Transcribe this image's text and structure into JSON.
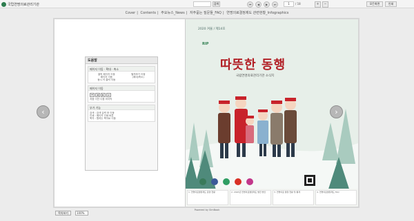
{
  "header": {
    "brand_text": "국립연명의료관리기관",
    "search_placeholder": "",
    "search_button": "검색",
    "nav": {
      "first": "⏮",
      "prev": "◀",
      "next": "▶",
      "last": "⏭"
    },
    "page_input_value": "1",
    "page_total": "/ 18",
    "buttons": {
      "fit": "모든화면",
      "print": "인쇄"
    }
  },
  "menu": {
    "items": [
      "Cover",
      "Contents",
      "주요뉴스_News",
      "자주묻는 질문들_FAQ",
      "연명의료결정제도 관련현황_Infographics"
    ],
    "separator": "|"
  },
  "help": {
    "title": "도움말",
    "sections": [
      {
        "heading": "페이지 이동 · 확대 · 축소",
        "left": "클릭 페이지 이동\n페이지 이동\n동시 키 클릭 이동",
        "right": "펼쳐보기 이동\n(확대/축소)"
      },
      {
        "heading": "페이지 이동",
        "icons": [
          "⏮",
          "◀",
          "▶",
          "⏭"
        ],
        "labels": "처음  이전  다음  마지막"
      },
      {
        "heading": "부가 기능",
        "text": "검색 : 검색 입력 후 이동\n인쇄 : 페이지 인쇄 버튼\n목차 : 원하는 목차로 이동"
      }
    ]
  },
  "cover": {
    "issue": "2020 겨울 / 제14호",
    "logo": "RIP",
    "title": "따뜻한 동행",
    "subtitle": "국립연명의료관리기관 소식지",
    "strip": [
      "1. 연명의료결정제도 운영 현황",
      "2. 2020년 연명의료결정제도 발전 방안",
      "3. 연명의료 결정 현황 및 통계",
      "4. 연명의료결정제도 FAQ"
    ]
  },
  "footer": {
    "button": "목차보기",
    "zoom_value": "100%",
    "powered": "Powered by SimBook"
  },
  "colors": {
    "title_red": "#b21f25",
    "cover_bg": "#e7efe9",
    "brand_green": "#2e7d4f"
  }
}
